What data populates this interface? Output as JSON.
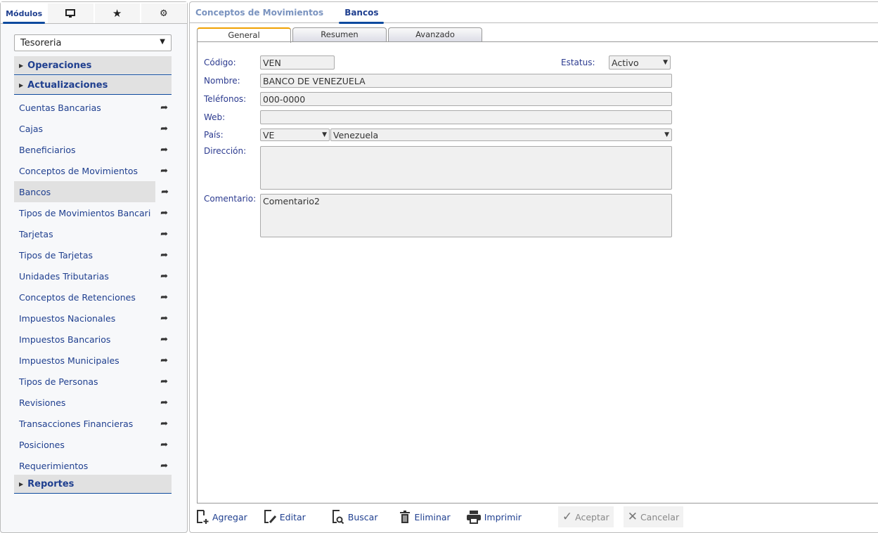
{
  "sidebar": {
    "tabs": [
      {
        "label": "Módulos"
      },
      {
        "icon": "monitor-icon"
      },
      {
        "icon": "star-icon"
      },
      {
        "icon": "gears-icon"
      }
    ],
    "module": "Tesoreria",
    "groups": {
      "operaciones": "Operaciones",
      "actualizaciones": "Actualizaciones",
      "reportes": "Reportes"
    },
    "items": [
      "Cuentas Bancarias",
      "Cajas",
      "Beneficiarios",
      "Conceptos de Movimientos",
      "Bancos",
      "Tipos de Movimientos Bancari",
      "Tarjetas",
      "Tipos de Tarjetas",
      "Unidades Tributarias",
      "Conceptos de Retenciones",
      "Impuestos Nacionales",
      "Impuestos Bancarios",
      "Impuestos Municipales",
      "Tipos de Personas",
      "Revisiones",
      "Transacciones Financieras",
      "Posiciones",
      "Requerimientos"
    ]
  },
  "main": {
    "tabs": [
      "Conceptos de Movimientos",
      "Bancos"
    ],
    "form_tabs": [
      "General",
      "Resumen",
      "Avanzado"
    ],
    "form": {
      "codigo_label": "Código:",
      "codigo": "VEN",
      "estatus_label": "Estatus:",
      "estatus": "Activo",
      "nombre_label": "Nombre:",
      "nombre": "BANCO DE VENEZUELA",
      "telefonos_label": "Teléfonos:",
      "telefonos": "000-0000",
      "web_label": "Web:",
      "web": "",
      "pais_label": "País:",
      "pais_code": "VE",
      "pais_name": "Venezuela",
      "direccion_label": "Dirección:",
      "direccion": "",
      "comentario_label": "Comentario:",
      "comentario": "Comentario2"
    },
    "toolbar": {
      "agregar": "Agregar",
      "editar": "Editar",
      "buscar": "Buscar",
      "eliminar": "Eliminar",
      "imprimir": "Imprimir",
      "aceptar": "Aceptar",
      "cancelar": "Cancelar"
    }
  }
}
